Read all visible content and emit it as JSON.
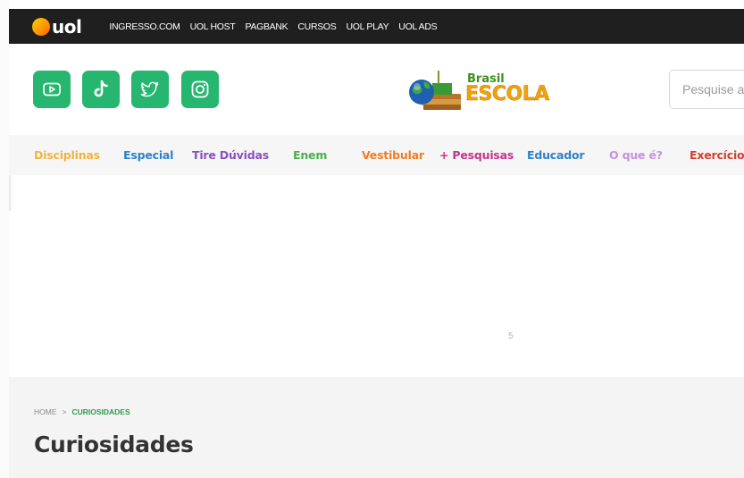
{
  "topbar": {
    "logo": "uol",
    "links": [
      "INGRESSO.COM",
      "UOL HOST",
      "PAGBANK",
      "CURSOS",
      "UOL PLAY",
      "UOL ADS"
    ]
  },
  "social": [
    {
      "name": "youtube-icon"
    },
    {
      "name": "tiktok-icon"
    },
    {
      "name": "twitter-icon"
    },
    {
      "name": "instagram-icon"
    }
  ],
  "brand": {
    "line1": "Brasil",
    "line2": "ESCOLA"
  },
  "search": {
    "placeholder": "Pesquise a"
  },
  "categories": [
    {
      "label": "Disciplinas",
      "color": "#f2b33d"
    },
    {
      "label": "Especial",
      "color": "#2f80c9"
    },
    {
      "label": "Tire Dúvidas",
      "color": "#8a4fc2"
    },
    {
      "label": "Enem",
      "color": "#48b04a"
    },
    {
      "label": "Vestibular",
      "color": "#ef7d22"
    },
    {
      "label": "+ Pesquisas",
      "color": "#c6348c"
    },
    {
      "label": "Educador",
      "color": "#2f80c9"
    },
    {
      "label": "O que é?",
      "color": "#c98fe0"
    },
    {
      "label": "Exercícios",
      "color": "#d63c2f"
    }
  ],
  "ad": {
    "number": "5"
  },
  "breadcrumb": {
    "home": "HOME",
    "separator": ">",
    "current": "CURIOSIDADES"
  },
  "page": {
    "title": "Curiosidades"
  },
  "colors": {
    "topbar": "#1f1f1f",
    "social": "#27b670",
    "title": "#333333",
    "breadcrumb_current": "#2e9a4b"
  }
}
